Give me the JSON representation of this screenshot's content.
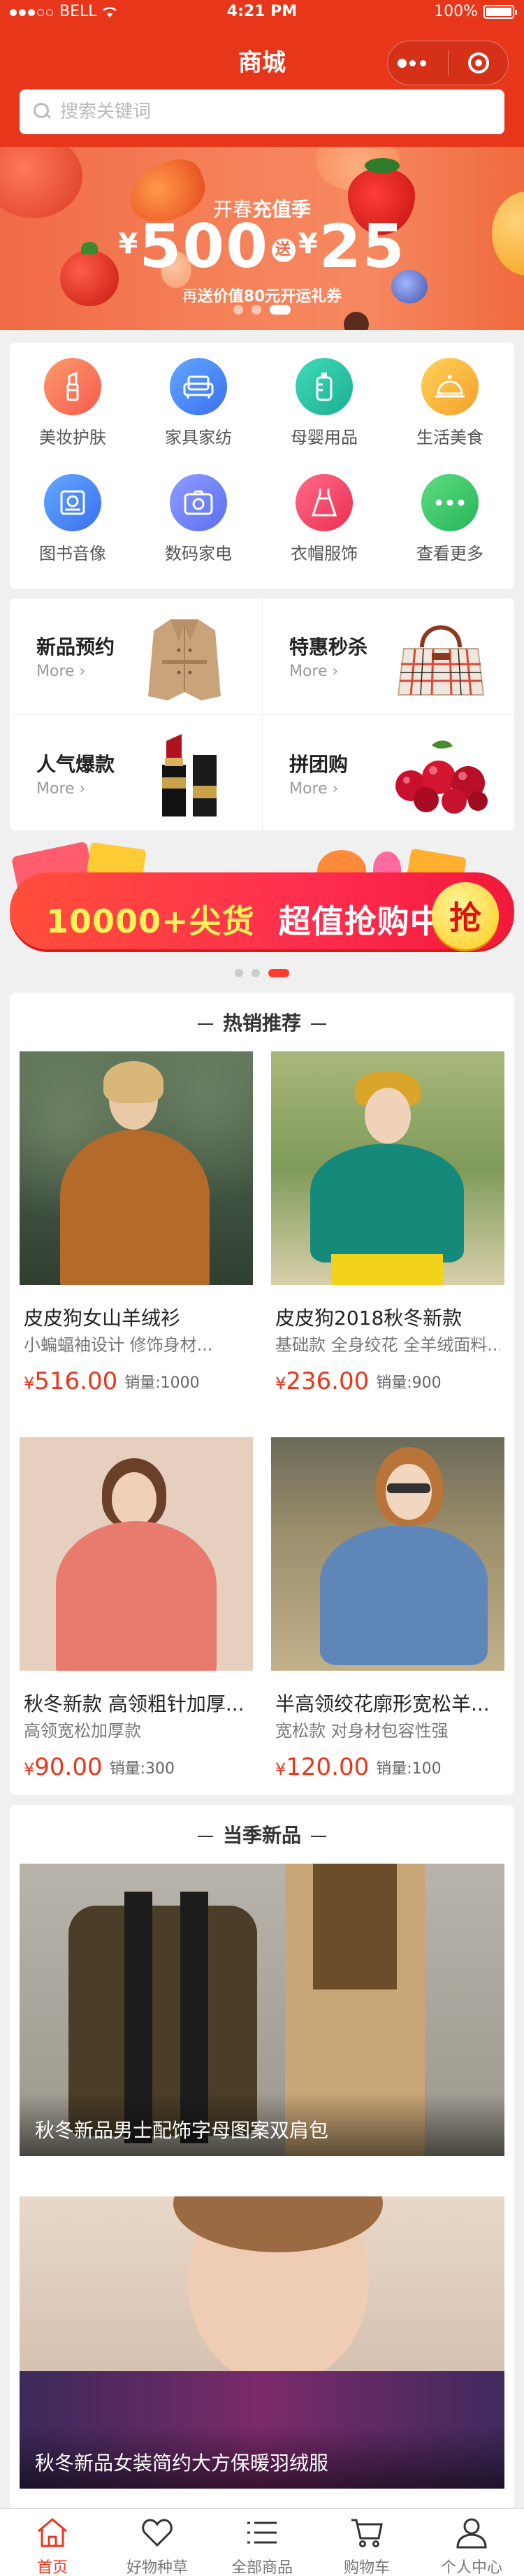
{
  "status_bar": {
    "carrier": "BELL",
    "time": "4:21 PM",
    "battery": "100%"
  },
  "nav": {
    "title": "商城"
  },
  "search": {
    "placeholder": "搜索关键词"
  },
  "banner": {
    "subtitle_prefix": "开春",
    "subtitle_bold": "充值季",
    "amount_a": "500",
    "join": "送",
    "amount_b": "25",
    "currency": "¥",
    "gift_prefix": "再",
    "gift_bold": "送价值80元开运礼券",
    "page_count": 3,
    "active_page": 3
  },
  "categories": [
    {
      "label": "美妆护肤",
      "icon": "lipstick-icon",
      "color": "#f7795c"
    },
    {
      "label": "家具家纺",
      "icon": "sofa-icon",
      "color": "#4f8df5"
    },
    {
      "label": "母婴用品",
      "icon": "baby-bottle-icon",
      "color": "#2cc6a6"
    },
    {
      "label": "生活美食",
      "icon": "food-cloche-icon",
      "color": "#fbb33a"
    },
    {
      "label": "图书音像",
      "icon": "book-icon",
      "color": "#4d8ff6"
    },
    {
      "label": "数码家电",
      "icon": "camera-icon",
      "color": "#6b86f6"
    },
    {
      "label": "衣帽服饰",
      "icon": "dress-icon",
      "color": "#f44d6a"
    },
    {
      "label": "查看更多",
      "icon": "more-icon",
      "color": "#3cc969"
    }
  ],
  "promos": [
    {
      "title": "新品预约",
      "more": "More",
      "image": "trench-coat"
    },
    {
      "title": "特惠秒杀",
      "more": "More",
      "image": "handbag"
    },
    {
      "title": "人气爆款",
      "more": "More",
      "image": "lipstick"
    },
    {
      "title": "拼团购",
      "more": "More",
      "image": "cranberries"
    }
  ],
  "flash_sale": {
    "amount": "10000+",
    "text_a": "尖货",
    "text_b": "超值抢购中",
    "button": "抢",
    "page_count": 3,
    "active_page": 3
  },
  "hot": {
    "title": "热销推荐",
    "products": [
      {
        "name": "皮皮狗女山羊绒衫",
        "desc": "小蝙蝠袖设计 修饰身材...",
        "currency": "¥",
        "price": "516.00",
        "sales": "销量:1000"
      },
      {
        "name": "皮皮狗2018秋冬新款",
        "desc": "基础款 全身绞花 全羊绒面料...",
        "currency": "¥",
        "price": "236.00",
        "sales": "销量:900"
      },
      {
        "name": "秋冬新款 高领粗针加厚...",
        "desc": "高领宽松加厚款",
        "currency": "¥",
        "price": "90.00",
        "sales": "销量:300"
      },
      {
        "name": "半高领绞花廓形宽松羊...",
        "desc": "宽松款 对身材包容性强",
        "currency": "¥",
        "price": "120.00",
        "sales": "销量:100"
      }
    ]
  },
  "new_season": {
    "title": "当季新品",
    "items": [
      {
        "caption": "秋冬新品男士配饰字母图案双肩包"
      },
      {
        "caption": "秋冬新品女装简约大方保暖羽绒服"
      }
    ]
  },
  "tabbar": {
    "active": 0,
    "tabs": [
      {
        "label": "首页",
        "icon": "home-icon"
      },
      {
        "label": "好物种草",
        "icon": "heart-icon"
      },
      {
        "label": "全部商品",
        "icon": "list-icon"
      },
      {
        "label": "购物车",
        "icon": "cart-icon"
      },
      {
        "label": "个人中心",
        "icon": "user-icon"
      }
    ]
  },
  "colors": {
    "brand": "#e8361b",
    "price": "#e8361b",
    "background": "#f0f0f0"
  }
}
